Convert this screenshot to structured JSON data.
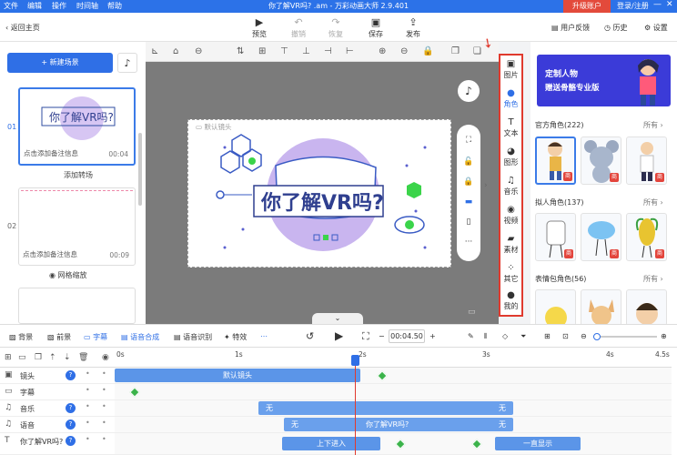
{
  "app": {
    "window_title": "你了解VR吗? .am - 万彩动画大师 2.9.401",
    "menu": [
      "文件",
      "编辑",
      "操作",
      "时间轴",
      "帮助"
    ],
    "upgrade": "升级账户",
    "login": "登录/注册"
  },
  "toolbar": {
    "back": "返回主页",
    "preview": "预览",
    "undo": "撤销",
    "redo": "恢复",
    "save": "保存",
    "publish": "发布",
    "feedback": "用户反馈",
    "history": "历史",
    "settings": "设置"
  },
  "left": {
    "new_scene": "+ 新建场景",
    "scenes": [
      {
        "num": "01",
        "note": "点击添加备注信息",
        "duration": "00:04",
        "thumb_text": "你了解VR吗?"
      },
      {
        "num": "02",
        "note": "点击添加备注信息",
        "duration": "00:09"
      }
    ],
    "add_transition": "添加转场",
    "grid_zoom": "网格缩放"
  },
  "stage": {
    "label": "默认镜头",
    "title": "你了解VR吗?"
  },
  "categories": [
    {
      "label": "图片",
      "icon": "image-icon"
    },
    {
      "label": "角色",
      "icon": "person-icon"
    },
    {
      "label": "文本",
      "icon": "text-icon"
    },
    {
      "label": "图形",
      "icon": "shape-icon"
    },
    {
      "label": "音乐",
      "icon": "music-icon"
    },
    {
      "label": "视频",
      "icon": "video-icon"
    },
    {
      "label": "素材",
      "icon": "folder-icon"
    },
    {
      "label": "其它",
      "icon": "other-icon"
    },
    {
      "label": "我的",
      "icon": "user-icon"
    }
  ],
  "right": {
    "banner_l1": "定制人物",
    "banner_l2": "赠送骨骼专业版",
    "sections": [
      {
        "title": "官方角色(222)",
        "more": "所有 ›"
      },
      {
        "title": "拟人角色(137)",
        "more": "所有 ›"
      },
      {
        "title": "表情包角色(56)",
        "more": "所有 ›"
      }
    ],
    "tag": "商"
  },
  "timebar": {
    "items": [
      "背景",
      "前景",
      "字幕",
      "语音合成",
      "语音识别",
      "特效"
    ],
    "time": "00:04.50"
  },
  "timeline": {
    "ticks": [
      "0s",
      "1s",
      "2s",
      "3s",
      "4s",
      "4.5s"
    ],
    "rows": [
      {
        "label": "镜头",
        "icon": "camera-icon"
      },
      {
        "label": "字幕",
        "icon": "subtitle-icon"
      },
      {
        "label": "音乐",
        "icon": "music-icon"
      },
      {
        "label": "语音",
        "icon": "voice-icon"
      },
      {
        "label": "你了解VR吗?",
        "icon": "text-icon"
      }
    ],
    "segments": {
      "camera": "默认镜头",
      "music_a": "无",
      "music_b": "无",
      "voice_a": "无",
      "voice_b": "无",
      "voice_c": "你了解VR吗?",
      "text_a": "上下进入",
      "text_b": "一直显示"
    }
  },
  "colors": {
    "accent": "#2f6fe6",
    "title_bg": "#2c72e8",
    "highlight": "#e03a2e",
    "keyframe": "#3bb34a"
  }
}
